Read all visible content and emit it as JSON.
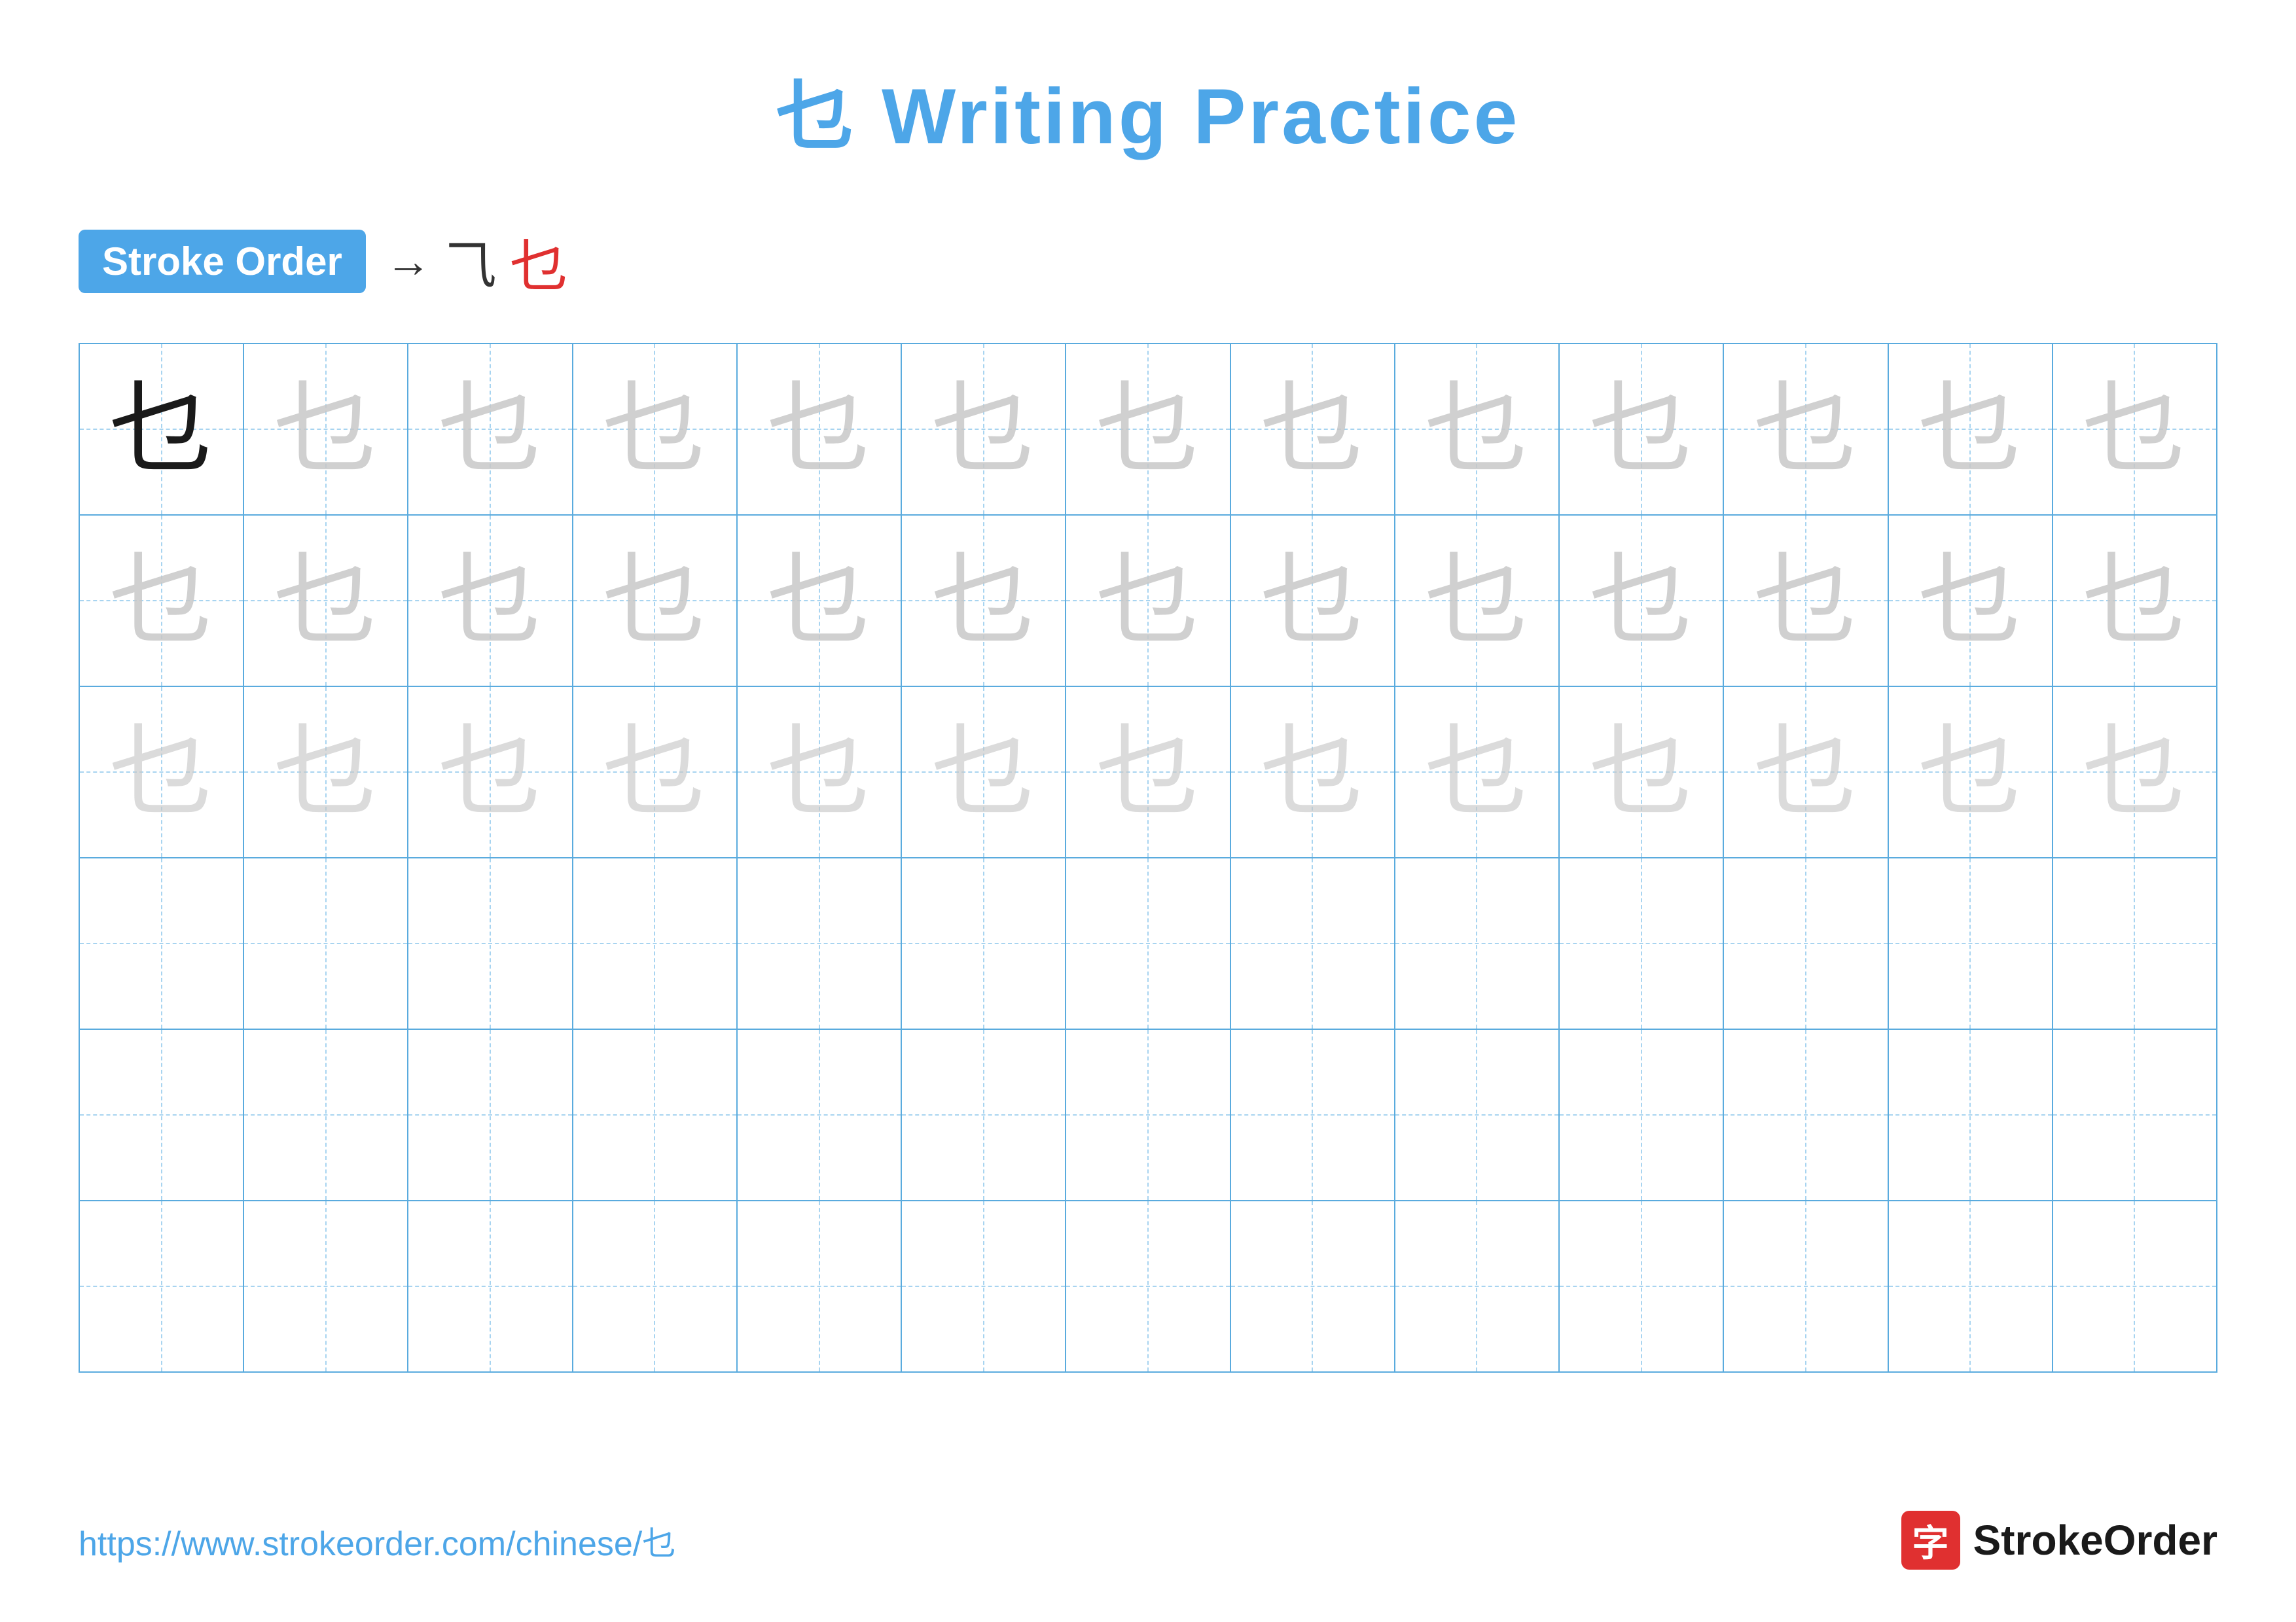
{
  "title": {
    "char": "乜",
    "label": "Writing Practice",
    "full": "乜 Writing Practice"
  },
  "stroke_order": {
    "badge_label": "Stroke Order",
    "arrow": "→",
    "stroke1": "⺄",
    "stroke2": "乜"
  },
  "grid": {
    "rows": 6,
    "cols": 13,
    "char": "乜",
    "row_types": [
      "dark_then_light1",
      "light1",
      "light2",
      "empty",
      "empty",
      "empty"
    ]
  },
  "footer": {
    "url": "https://www.strokeorder.com/chinese/乜",
    "logo_icon": "字",
    "logo_text": "StrokeOrder"
  }
}
